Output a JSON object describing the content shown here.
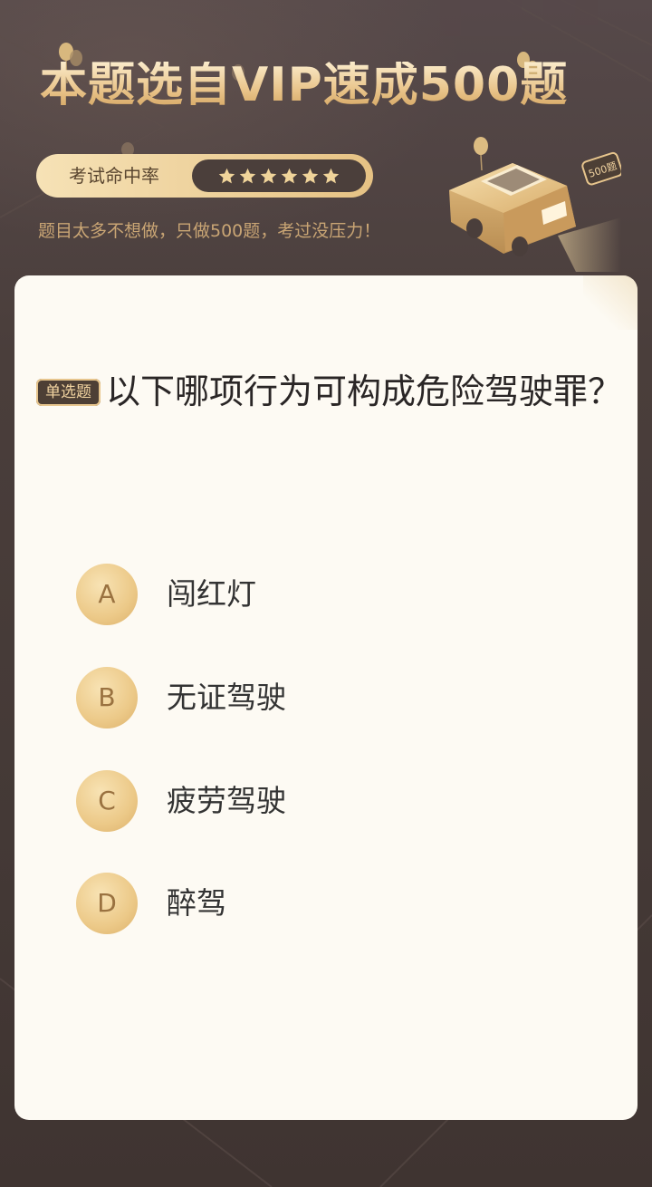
{
  "header": {
    "title": "本题选自VIP速成500题",
    "rate_label": "考试命中率",
    "stars": 6,
    "subtitle": "题目太多不想做，只做500题，考过没压力！",
    "car_plate": "500题"
  },
  "question": {
    "type_badge": "单选题",
    "text": "以下哪项行为可构成危险驾驶罪？",
    "options": [
      {
        "letter": "A",
        "text": "闯红灯"
      },
      {
        "letter": "B",
        "text": "无证驾驶"
      },
      {
        "letter": "C",
        "text": "疲劳驾驶"
      },
      {
        "letter": "D",
        "text": "醉驾"
      }
    ]
  },
  "colors": {
    "gold": "#e9c48a",
    "dark_bg": "#4a3e3b",
    "card_bg": "#fdfaf3"
  }
}
